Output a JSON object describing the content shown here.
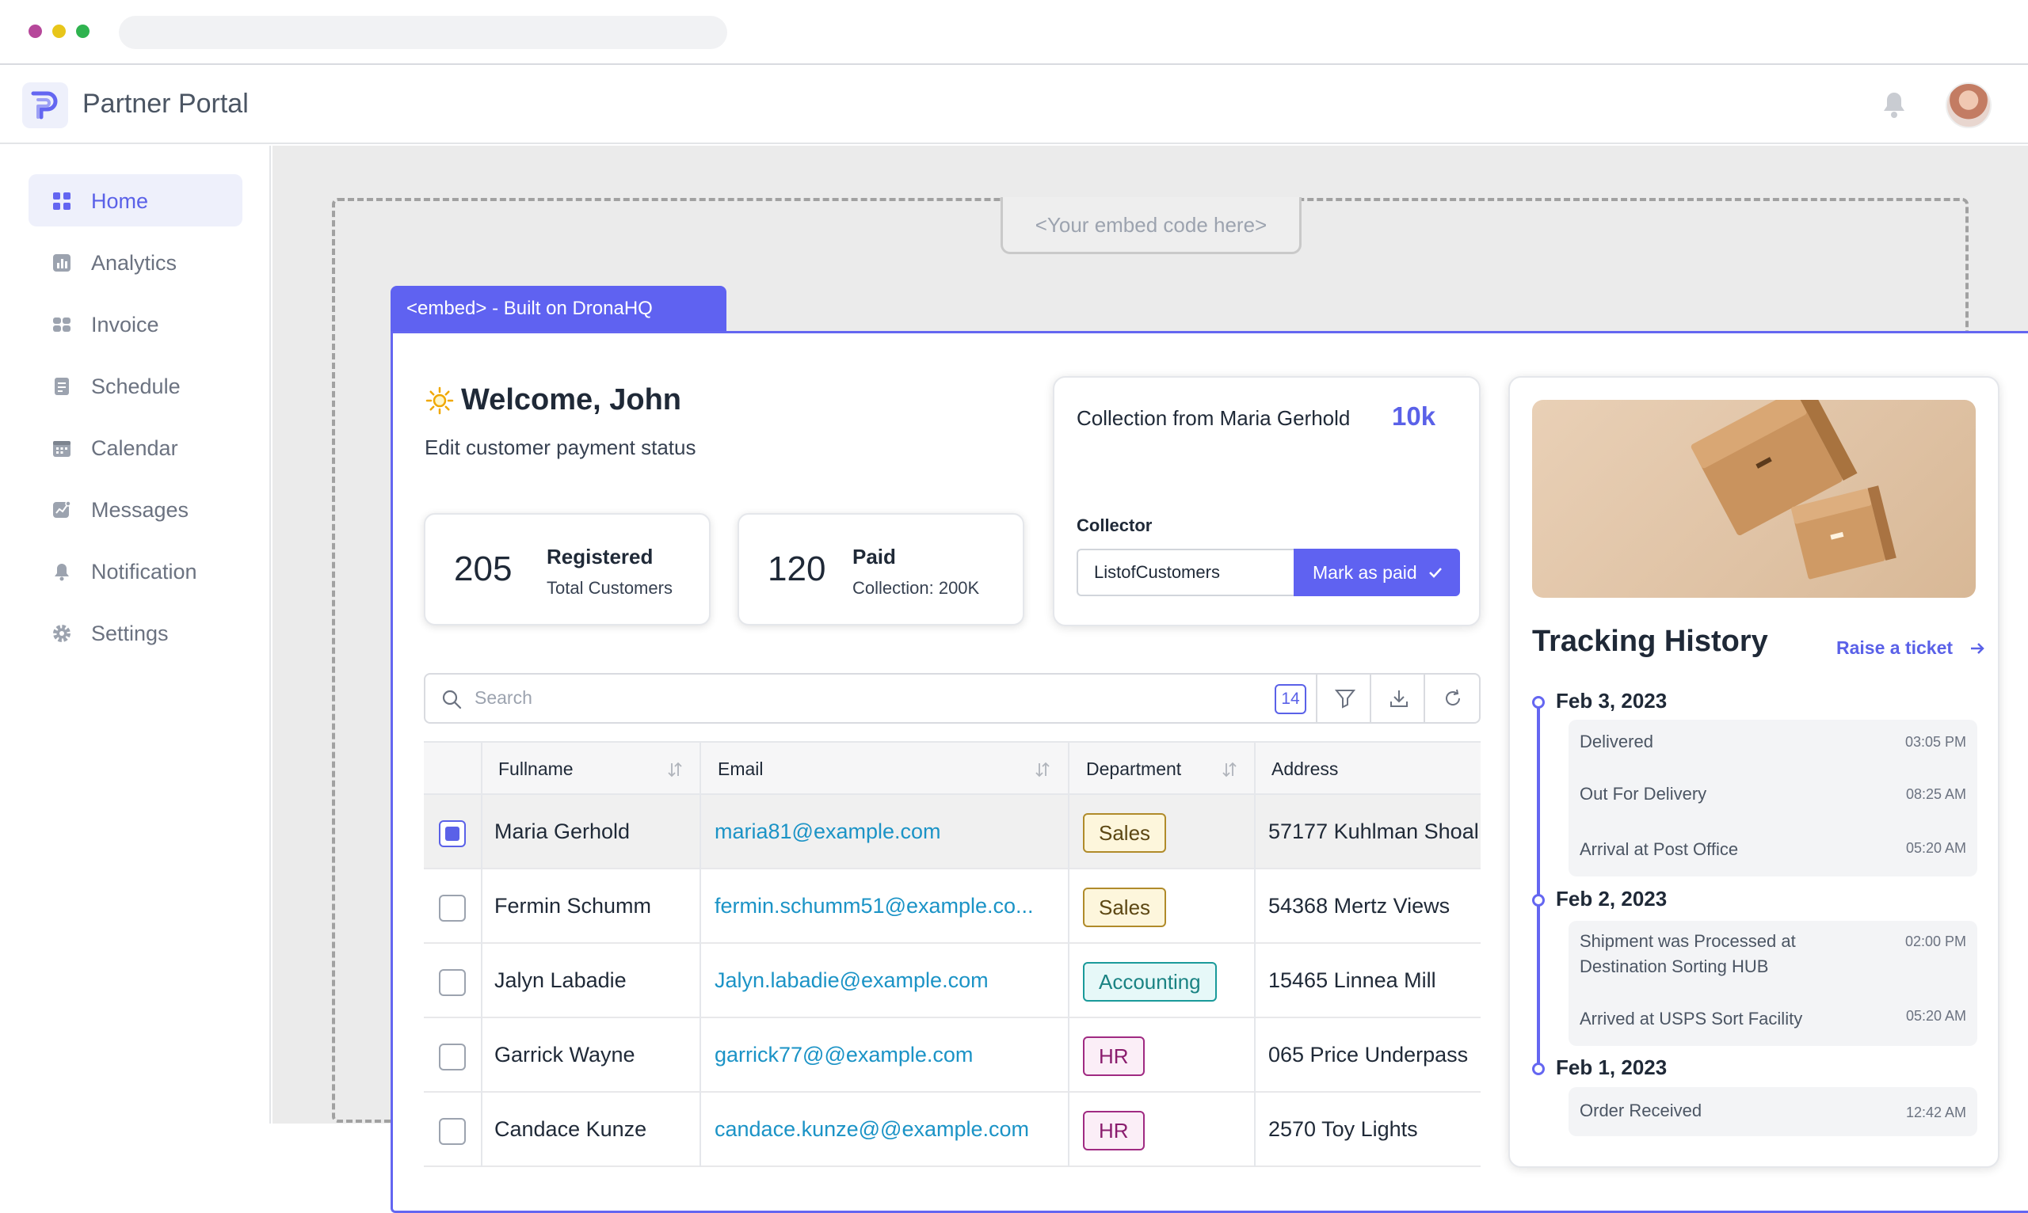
{
  "app": {
    "title": "Partner Portal"
  },
  "sidebar": {
    "items": [
      {
        "label": "Home",
        "icon": "grid-icon",
        "active": true
      },
      {
        "label": "Analytics",
        "icon": "bar-chart-icon"
      },
      {
        "label": "Invoice",
        "icon": "invoice-icon"
      },
      {
        "label": "Schedule",
        "icon": "document-icon"
      },
      {
        "label": "Calendar",
        "icon": "calendar-icon"
      },
      {
        "label": "Messages",
        "icon": "chat-icon"
      },
      {
        "label": "Notification",
        "icon": "bell-icon"
      },
      {
        "label": "Settings",
        "icon": "gear-icon"
      }
    ]
  },
  "embed": {
    "placeholder": "<Your embed code here>",
    "tab_label": "<embed> - Built on DronaHQ"
  },
  "welcome": {
    "title": "Welcome, John",
    "subtitle": "Edit customer payment status"
  },
  "stats": [
    {
      "value": "205",
      "title": "Registered",
      "subtitle": "Total Customers"
    },
    {
      "value": "120",
      "title": "Paid",
      "subtitle": "Collection: 200K"
    }
  ],
  "collection": {
    "title": "Collection from Maria Gerhold",
    "amount": "10k",
    "collector_label": "Collector",
    "collector_value": "ListofCustomers",
    "button_label": "Mark as paid"
  },
  "search": {
    "placeholder": "Search",
    "count": "14"
  },
  "table": {
    "columns": [
      "Fullname",
      "Email",
      "Department",
      "Address"
    ],
    "rows": [
      {
        "name": "Maria Gerhold",
        "email": "maria81@example.com",
        "department": "Sales",
        "address": "57177 Kuhlman Shoal",
        "checked": true
      },
      {
        "name": "Fermin Schumm",
        "email": "fermin.schumm51@example.co...",
        "department": "Sales",
        "address": "54368 Mertz Views",
        "checked": false
      },
      {
        "name": "Jalyn Labadie",
        "email": "Jalyn.labadie@example.com",
        "department": "Accounting",
        "address": "15465 Linnea Mill",
        "checked": false
      },
      {
        "name": "Garrick Wayne",
        "email": "garrick77@@example.com",
        "department": "HR",
        "address": "065 Price Underpass",
        "checked": false
      },
      {
        "name": "Candace Kunze",
        "email": "candace.kunze@@example.com",
        "department": "HR",
        "address": "2570 Toy Lights",
        "checked": false
      }
    ]
  },
  "tracking": {
    "title": "Tracking History",
    "raise_label": "Raise a ticket",
    "groups": [
      {
        "date": "Feb 3, 2023",
        "events": [
          {
            "text": "Delivered",
            "time": "03:05 PM"
          },
          {
            "text": "Out For Delivery",
            "time": "08:25 AM"
          },
          {
            "text": "Arrival at Post Office",
            "time": "05:20 AM"
          }
        ]
      },
      {
        "date": "Feb 2, 2023",
        "events": [
          {
            "text": "Shipment was Processed at Destination Sorting HUB",
            "time": "02:00 PM"
          },
          {
            "text": "Arrived at USPS Sort Facility",
            "time": "05:20 AM"
          }
        ]
      },
      {
        "date": "Feb 1, 2023",
        "events": [
          {
            "text": "Order Received",
            "time": "12:42 AM"
          }
        ]
      }
    ]
  },
  "colors": {
    "accent": "#5f62f1",
    "link": "#1b93c6",
    "sales_bg": "#fdf6dc",
    "accounting_bg": "#e6f8f8",
    "hr_bg": "#fbeef7"
  }
}
